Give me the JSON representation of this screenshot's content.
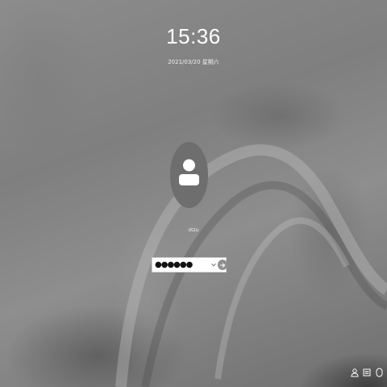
{
  "lockscreen": {
    "time": "15:36",
    "date": "2021/03/20 星期六",
    "username": "otzu"
  },
  "login": {
    "password_mask": "●●●●●●",
    "keyboard_icon": "keyboard-toggle-icon",
    "submit_icon": "arrow-right-icon"
  },
  "tray": {
    "icons": [
      "switch-user-icon",
      "keyboard-layout-icon",
      "power-icon"
    ]
  }
}
